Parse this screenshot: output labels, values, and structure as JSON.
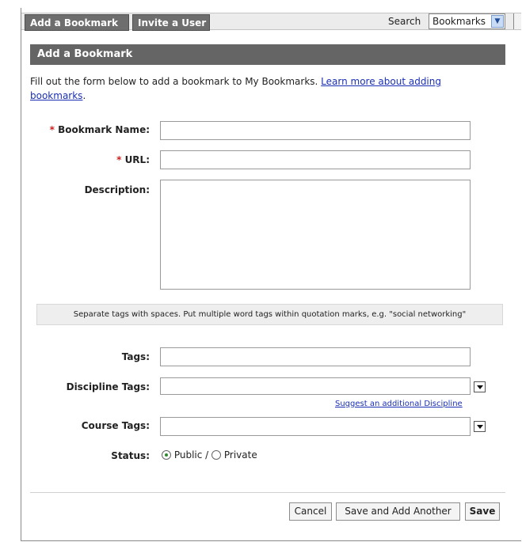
{
  "tabs": {
    "add_bookmark": "Add a Bookmark",
    "invite_user": "Invite a User"
  },
  "search": {
    "label": "Search",
    "selected": "Bookmarks"
  },
  "panel": {
    "title": "Add a Bookmark"
  },
  "intro": {
    "text": "Fill out the form below to add a bookmark to My Bookmarks.",
    "link": "Learn more about adding bookmarks",
    "trailing": "."
  },
  "form": {
    "required_mark": "*",
    "bookmark_name_label": "Bookmark Name:",
    "url_label": "URL:",
    "description_label": "Description:",
    "tags_hint": "Separate tags with spaces. Put multiple word tags within quotation marks, e.g. \"social networking\"",
    "tags_label": "Tags:",
    "discipline_tags_label": "Discipline Tags:",
    "suggest_link": "Suggest an additional Discipline",
    "course_tags_label": "Course Tags:",
    "status_label": "Status:",
    "status_public": "Public",
    "status_separator": "/",
    "status_private": "Private",
    "status_selected": "Public"
  },
  "buttons": {
    "cancel": "Cancel",
    "save_add_another": "Save and Add Another",
    "save": "Save"
  },
  "colors": {
    "header_bg": "#656565",
    "link": "#1a2fb3",
    "required": "#d0201a"
  }
}
